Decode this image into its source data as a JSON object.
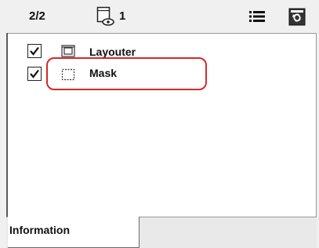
{
  "header": {
    "page_count": "2/2",
    "preview_count": "1",
    "icons": {
      "preview": "page-preview-icon",
      "list": "list-view-icon",
      "trash": "delete-icon"
    }
  },
  "layers": [
    {
      "label": "Layouter",
      "checked": true,
      "icon": "layouter-layer-icon"
    },
    {
      "label": "Mask",
      "checked": true,
      "icon": "mask-layer-icon"
    }
  ],
  "tabs": {
    "active_label": "Information"
  },
  "colors": {
    "highlight": "#d32a2a",
    "panel_bg": "#ffffff",
    "chrome_bg": "#f0f0f0"
  }
}
